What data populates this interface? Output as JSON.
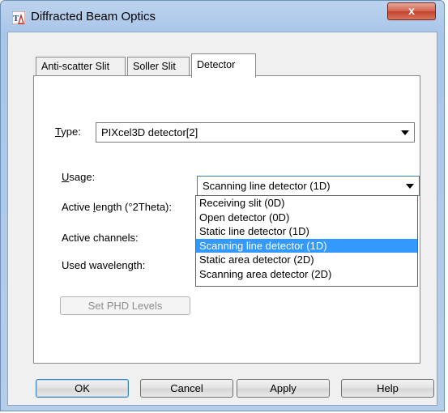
{
  "window": {
    "title": "Diffracted Beam Optics",
    "close_glyph": "x"
  },
  "tabs": [
    {
      "label": "Anti-scatter Slit",
      "active": false
    },
    {
      "label": "Soller Slit",
      "active": false
    },
    {
      "label": "Detector",
      "active": true
    }
  ],
  "type": {
    "label_ul": "T",
    "label_rest": "ype:",
    "value": "PIXcel3D detector[2]"
  },
  "usage": {
    "label_ul": "U",
    "label_rest": "sage:",
    "value": "Scanning line detector (1D)"
  },
  "active_length": {
    "label_pre": "Active ",
    "label_ul": "l",
    "label_rest": "ength (°2Theta):"
  },
  "active_channels": {
    "label": "Active channels:"
  },
  "used_wavelength": {
    "label": "Used wavelength:"
  },
  "set_phd_button": "Set PHD Levels",
  "usage_options": [
    "Receiving slit (0D)",
    "Open detector (0D)",
    "Static line detector (1D)",
    "Scanning line detector (1D)",
    "Static area detector (2D)",
    "Scanning area detector (2D)"
  ],
  "usage_selected_index": 3,
  "buttons": {
    "ok": "OK",
    "cancel": "Cancel",
    "apply": "Apply",
    "help": "Help"
  },
  "colors": {
    "selection": "#3399ff",
    "title_bar": "#b6cde9",
    "close_button": "#c2412b"
  }
}
